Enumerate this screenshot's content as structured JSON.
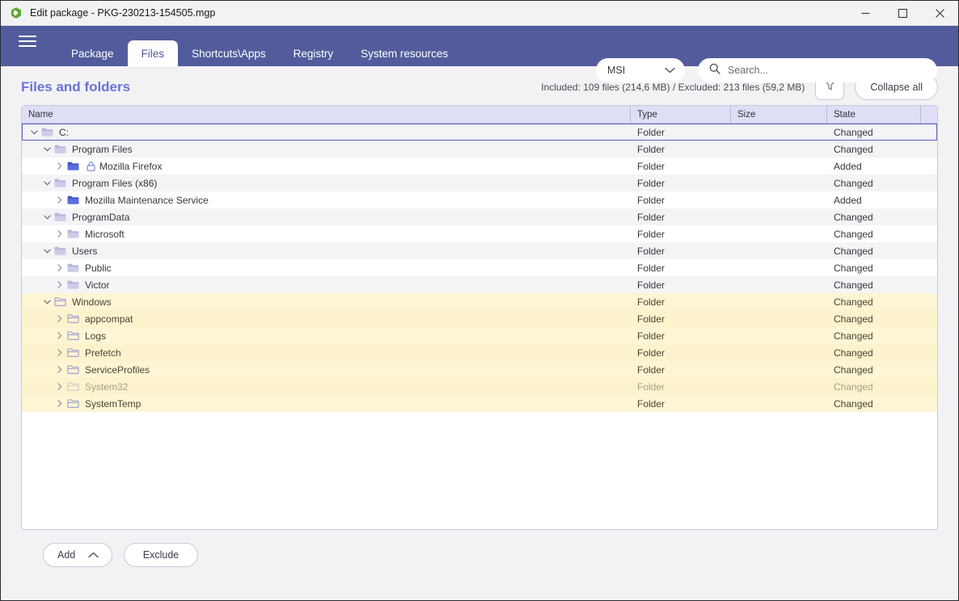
{
  "window": {
    "title": "Edit package - PKG-230213-154505.mgp",
    "minimize_label": "Minimize",
    "maximize_label": "Maximize",
    "close_label": "Close"
  },
  "nav": {
    "menu_label": "Menu",
    "tabs": [
      {
        "label": "Package",
        "active": false
      },
      {
        "label": "Files",
        "active": true
      },
      {
        "label": "Shortcuts\\Apps",
        "active": false
      },
      {
        "label": "Registry",
        "active": false
      },
      {
        "label": "System resources",
        "active": false
      }
    ],
    "type_select": {
      "value": "MSI"
    },
    "search": {
      "value": "",
      "placeholder": "Search..."
    }
  },
  "page": {
    "title": "Files and folders",
    "stats": "Included: 109 files (214,6 MB) / Excluded: 213 files (59,2 MB)",
    "filter_label": "Filter",
    "collapse_label": "Collapse all"
  },
  "table": {
    "columns": [
      "Name",
      "Type",
      "Size",
      "State"
    ],
    "rows": [
      {
        "name": "C:",
        "type": "Folder",
        "size": "",
        "state": "Changed",
        "level": 0,
        "expanded": true,
        "icon": "folder-grey",
        "locked": false,
        "highlight": false,
        "selected": true,
        "dimmed": false
      },
      {
        "name": "Program Files",
        "type": "Folder",
        "size": "",
        "state": "Changed",
        "level": 1,
        "expanded": true,
        "icon": "folder-grey",
        "locked": false,
        "highlight": false,
        "selected": false,
        "dimmed": false
      },
      {
        "name": "Mozilla Firefox",
        "type": "Folder",
        "size": "",
        "state": "Added",
        "level": 2,
        "expanded": false,
        "icon": "folder-blue",
        "locked": true,
        "highlight": false,
        "selected": false,
        "dimmed": false
      },
      {
        "name": "Program Files (x86)",
        "type": "Folder",
        "size": "",
        "state": "Changed",
        "level": 1,
        "expanded": true,
        "icon": "folder-grey",
        "locked": false,
        "highlight": false,
        "selected": false,
        "dimmed": false
      },
      {
        "name": "Mozilla Maintenance Service",
        "type": "Folder",
        "size": "",
        "state": "Added",
        "level": 2,
        "expanded": false,
        "icon": "folder-blue",
        "locked": false,
        "highlight": false,
        "selected": false,
        "dimmed": false
      },
      {
        "name": "ProgramData",
        "type": "Folder",
        "size": "",
        "state": "Changed",
        "level": 1,
        "expanded": true,
        "icon": "folder-grey",
        "locked": false,
        "highlight": false,
        "selected": false,
        "dimmed": false
      },
      {
        "name": "Microsoft",
        "type": "Folder",
        "size": "",
        "state": "Changed",
        "level": 2,
        "expanded": false,
        "icon": "folder-grey",
        "locked": false,
        "highlight": false,
        "selected": false,
        "dimmed": false
      },
      {
        "name": "Users",
        "type": "Folder",
        "size": "",
        "state": "Changed",
        "level": 1,
        "expanded": true,
        "icon": "folder-grey",
        "locked": false,
        "highlight": false,
        "selected": false,
        "dimmed": false
      },
      {
        "name": "Public",
        "type": "Folder",
        "size": "",
        "state": "Changed",
        "level": 2,
        "expanded": false,
        "icon": "folder-grey",
        "locked": false,
        "highlight": false,
        "selected": false,
        "dimmed": false
      },
      {
        "name": "Victor",
        "type": "Folder",
        "size": "",
        "state": "Changed",
        "level": 2,
        "expanded": false,
        "icon": "folder-grey",
        "locked": false,
        "highlight": false,
        "selected": false,
        "dimmed": false
      },
      {
        "name": "Windows",
        "type": "Folder",
        "size": "",
        "state": "Changed",
        "level": 1,
        "expanded": true,
        "icon": "folder-outline",
        "locked": false,
        "highlight": true,
        "selected": false,
        "dimmed": false
      },
      {
        "name": "appcompat",
        "type": "Folder",
        "size": "",
        "state": "Changed",
        "level": 2,
        "expanded": false,
        "icon": "folder-outline",
        "locked": false,
        "highlight": true,
        "selected": false,
        "dimmed": false
      },
      {
        "name": "Logs",
        "type": "Folder",
        "size": "",
        "state": "Changed",
        "level": 2,
        "expanded": false,
        "icon": "folder-outline",
        "locked": false,
        "highlight": true,
        "selected": false,
        "dimmed": false
      },
      {
        "name": "Prefetch",
        "type": "Folder",
        "size": "",
        "state": "Changed",
        "level": 2,
        "expanded": false,
        "icon": "folder-outline",
        "locked": false,
        "highlight": true,
        "selected": false,
        "dimmed": false
      },
      {
        "name": "ServiceProfiles",
        "type": "Folder",
        "size": "",
        "state": "Changed",
        "level": 2,
        "expanded": false,
        "icon": "folder-outline",
        "locked": false,
        "highlight": true,
        "selected": false,
        "dimmed": false
      },
      {
        "name": "System32",
        "type": "Folder",
        "size": "",
        "state": "Changed",
        "level": 2,
        "expanded": false,
        "icon": "folder-outline",
        "locked": false,
        "highlight": true,
        "selected": false,
        "dimmed": true
      },
      {
        "name": "SystemTemp",
        "type": "Folder",
        "size": "",
        "state": "Changed",
        "level": 2,
        "expanded": false,
        "icon": "folder-outline",
        "locked": false,
        "highlight": true,
        "selected": false,
        "dimmed": false
      }
    ]
  },
  "actions": {
    "add_label": "Add",
    "exclude_label": "Exclude"
  },
  "colors": {
    "navbar": "#525c9c",
    "title_accent": "#6b74d4",
    "header_bg": "#dedef6",
    "highlight_row": "#fdf5d3",
    "selection_border": "#5b63c4",
    "folder_grey": "#c3c3e0",
    "folder_blue": "#4558c8"
  }
}
